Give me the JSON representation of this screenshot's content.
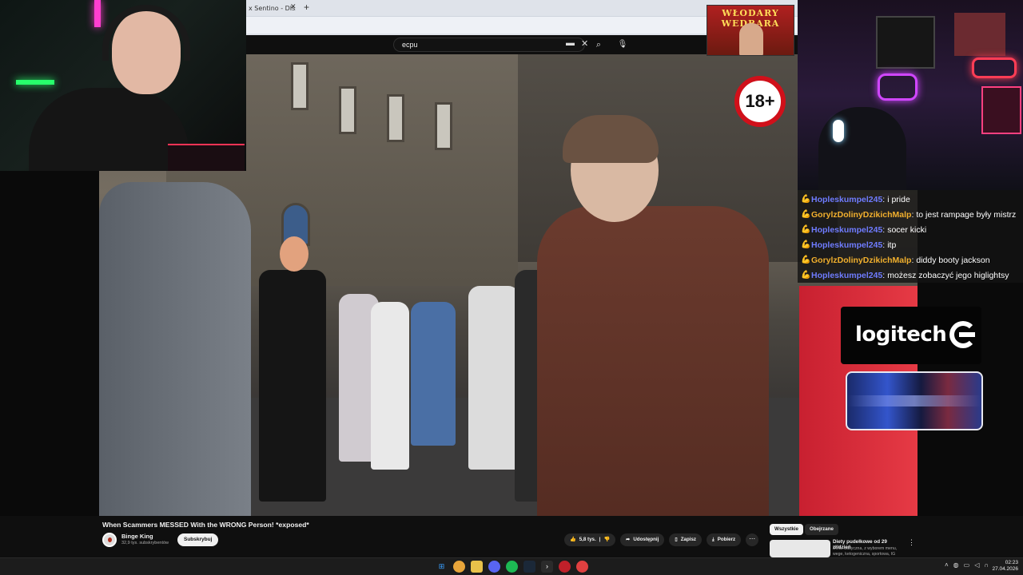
{
  "browser": {
    "tab_label": "x Sentino - DIss",
    "tab_close": "✕",
    "new_tab": "+"
  },
  "youtube": {
    "search_query": "ecpu",
    "video_title": "When Scammers MESSED With the WRONG Person! *exposed*",
    "channel_name": "Binge King",
    "subscribers": "32,9 tys. subskrybentów",
    "subscribe_label": "Subskrybuj",
    "like_count": "5,8 tys.",
    "share_label": "Udostępnij",
    "save_label": "Zapisz",
    "download_label": "Pobierz",
    "filters": [
      "Wszystkie",
      "Obejrzane"
    ],
    "recommendation": {
      "title": "Diety pudełkowe od 29 zł/dzień",
      "meta": "Dieta klasyczna, z wyborem menu, wege, ketogeniczna, sportowa, IG"
    }
  },
  "overlay": {
    "age_badge": "18+",
    "banner_text": "WŁODARY WEDRARA",
    "logitech": "logitech"
  },
  "chat": [
    {
      "user": "Hopleskumpel245",
      "color": "#6f7cff",
      "message": "i pride"
    },
    {
      "user": "GorylzDolinyDzikichMalp",
      "color": "#f2b02e",
      "message": "to jest rampage były mistrz"
    },
    {
      "user": "Hopleskumpel245",
      "color": "#6f7cff",
      "message": "socer kicki"
    },
    {
      "user": "Hopleskumpel245",
      "color": "#6f7cff",
      "message": "itp"
    },
    {
      "user": "GorylzDolinyDzikichMalp",
      "color": "#f2b02e",
      "message": "diddy booty jackson"
    },
    {
      "user": "Hopleskumpel245",
      "color": "#6f7cff",
      "message": "możesz zobaczyć jego higlightsy"
    }
  ],
  "taskbar": {
    "time": "02:23",
    "date": "27.04.2026",
    "apps": [
      "windows-start",
      "chrome",
      "file-explorer",
      "discord",
      "spotify",
      "steam",
      "terminal",
      "app-red",
      "chrome-alt"
    ]
  }
}
